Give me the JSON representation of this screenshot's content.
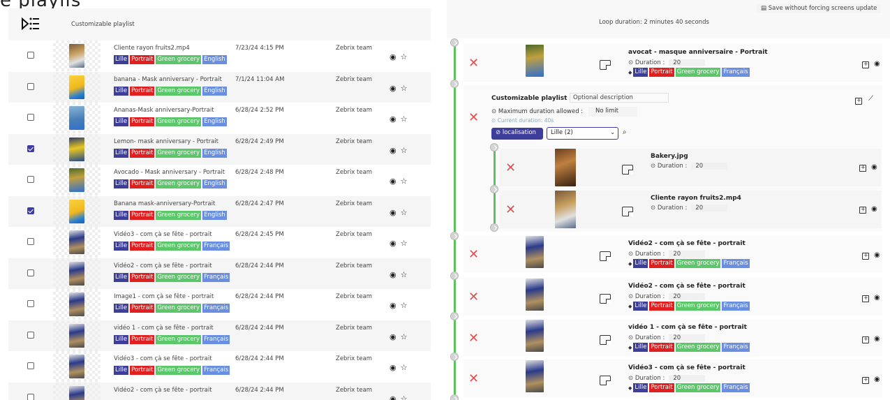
{
  "page_title_fragment": "e playlis",
  "left": {
    "header_label": "Customizable playlist",
    "tag_colors": {
      "Lille": "#3d3d9a",
      "Portrait": "#e02020",
      "Green grocery": "#5cc76a",
      "English": "#6b8fe0",
      "Français": "#6b8fe0"
    },
    "rows": [
      {
        "name": "Cliente rayon fruits2.mp4",
        "date": "7/23/24 4:15 PM",
        "team": "Zebrix team",
        "tags": [
          "Lille",
          "Portrait",
          "Green grocery",
          "English"
        ],
        "checked": false,
        "thumb": "fruit"
      },
      {
        "name": "banana - Mask anniversary - Portrait",
        "date": "7/1/24 11:04 AM",
        "team": "Zebrix team",
        "tags": [
          "Lille",
          "Portrait",
          "Green grocery",
          "English"
        ],
        "checked": false,
        "thumb": "banana"
      },
      {
        "name": "Ananas-Mask anniversary-Portrait",
        "date": "6/28/24 2:52 PM",
        "team": "Zebrix team",
        "tags": [
          "Lille",
          "Portrait",
          "Green grocery",
          "English"
        ],
        "checked": false,
        "thumb": "ananas"
      },
      {
        "name": "Lemon- mask anniversary - Portrait",
        "date": "6/28/24 2:49 PM",
        "team": "Zebrix team",
        "tags": [
          "Lille",
          "Portrait",
          "Green grocery",
          "English"
        ],
        "checked": true,
        "thumb": "lemon"
      },
      {
        "name": "Avocado - Mask anniversary - Portrait",
        "date": "6/28/24 2:48 PM",
        "team": "Zebrix team",
        "tags": [
          "Lille",
          "Portrait",
          "Green grocery",
          "English"
        ],
        "checked": false,
        "thumb": "avocado"
      },
      {
        "name": "Banana mask-anniversary-Portrait",
        "date": "6/28/24 2:47 PM",
        "team": "Zebrix team",
        "tags": [
          "Lille",
          "Portrait",
          "Green grocery",
          "English"
        ],
        "checked": true,
        "thumb": "banana"
      },
      {
        "name": "Vidéo3 - com çà se fête - portrait",
        "date": "6/28/24 2:45 PM",
        "team": "Zebrix team",
        "tags": [
          "Lille",
          "Portrait",
          "Green grocery",
          "Français"
        ],
        "checked": false,
        "thumb": "video"
      },
      {
        "name": "Vidéo2 - com çà se fête - portrait",
        "date": "6/28/24 2:44 PM",
        "team": "Zebrix team",
        "tags": [
          "Lille",
          "Portrait",
          "Green grocery",
          "Français"
        ],
        "checked": false,
        "thumb": "video"
      },
      {
        "name": "Image1 - com çà se fête - portrait",
        "date": "6/28/24 2:44 PM",
        "team": "Zebrix team",
        "tags": [
          "Lille",
          "Portrait",
          "Green grocery",
          "Français"
        ],
        "checked": false,
        "thumb": "video"
      },
      {
        "name": "vidéo 1 - com çà se fête - portrait",
        "date": "6/28/24 2:44 PM",
        "team": "Zebrix team",
        "tags": [
          "Lille",
          "Portrait",
          "Green grocery",
          "Français"
        ],
        "checked": false,
        "thumb": "video"
      },
      {
        "name": "Vidéo3 - com çà se fête - portrait",
        "date": "6/28/24 2:44 PM",
        "team": "Zebrix team",
        "tags": [
          "Lille",
          "Portrait",
          "Green grocery",
          "Français"
        ],
        "checked": false,
        "thumb": "video"
      },
      {
        "name": "Vidéo2 - com çà se fête - portrait",
        "date": "6/28/24 2:44 PM",
        "team": "Zebrix team",
        "tags": [],
        "checked": false,
        "thumb": "video"
      }
    ]
  },
  "right": {
    "save_label": "Save without forcing screens update",
    "loop_duration": "Loop duration: 2 minutes 40 seconds",
    "duration_label": "Duration :",
    "items": [
      {
        "title": "avocat - masque anniversaire - Portrait",
        "duration": "20",
        "tags": [
          "Lille",
          "Portrait",
          "Green grocery",
          "Français"
        ],
        "thumb": "avocado"
      },
      {
        "title": "Vidéo2 - com çà se fête - portrait",
        "duration": "20",
        "tags": [
          "Lille",
          "Portrait",
          "Green grocery",
          "Français"
        ],
        "thumb": "video"
      },
      {
        "title": "Vidéo2 - com çà se fête - portrait",
        "duration": "20",
        "tags": [
          "Lille",
          "Portrait",
          "Green grocery",
          "Français"
        ],
        "thumb": "video"
      },
      {
        "title": "vidéo 1 - com çà se fête - portrait",
        "duration": "20",
        "tags": [
          "Lille",
          "Portrait",
          "Green grocery",
          "Français"
        ],
        "thumb": "video"
      },
      {
        "title": "Vidéo3 - com çà se fête - portrait",
        "duration": "20",
        "tags": [
          "Lille",
          "Portrait",
          "Green grocery",
          "Français"
        ],
        "thumb": "video"
      }
    ],
    "playlist": {
      "title": "Customizable playlist",
      "description_placeholder": "Optional description",
      "max_label": "Maximum duration allowed :",
      "max_value": "No limit",
      "current": "Current duration: 40s",
      "loc_button": "localisation",
      "loc_select": "Lille (2)",
      "children": [
        {
          "title": "Bakery.jpg",
          "duration": "20",
          "thumb": "bakery"
        },
        {
          "title": "Cliente rayon fruits2.mp4",
          "duration": "20",
          "thumb": "fruit"
        }
      ]
    }
  }
}
